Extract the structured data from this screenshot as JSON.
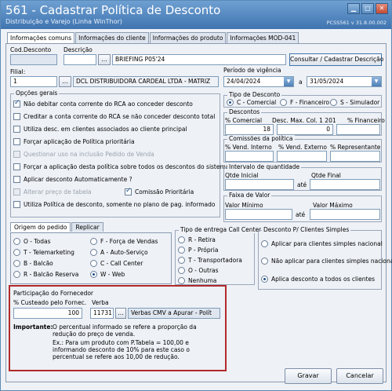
{
  "window": {
    "title": "561 - Cadastrar Política de Desconto",
    "subtitle": "Distribuição e Varejo (Linha WinThor)",
    "version": "PCSS561 v 31.8.00.002"
  },
  "tabs": [
    "Informações comuns",
    "Informações do cliente",
    "Informações do produto",
    "Informações MOD-041"
  ],
  "header": {
    "cod_desconto_label": "Cod.Desconto",
    "cod_desconto_value": "",
    "descricao_label": "Descrição",
    "descricao_code": "",
    "descricao_value": "BRIEFING P05'24",
    "consultar_button": "Consultar / Cadastrar Descrição",
    "filial_label": "Filial:",
    "filial_code": "1",
    "filial_name": "DCL DISTRIBUIDORA CARDEAL LTDA - MATRIZ",
    "vigencia_label": "Período de vigência",
    "vigencia_start": "24/04/2024",
    "vigencia_sep": "a",
    "vigencia_end": "31/05/2024"
  },
  "opcoes_gerais": {
    "title": "Opções gerais",
    "items": [
      {
        "label": "Não debitar conta corrente do RCA ao conceder desconto",
        "checked": true,
        "disabled": false
      },
      {
        "label": "Creditar a conta corrente do RCA se não conceder desconto total",
        "checked": false,
        "disabled": false
      },
      {
        "label": "Utiliza desc. em clientes associados ao cliente principal",
        "checked": false,
        "disabled": false
      },
      {
        "label": "Forçar aplicação de Política prioritária",
        "checked": false,
        "disabled": false
      },
      {
        "label": "Questionar uso na inclusão Pedido de Venda",
        "checked": false,
        "disabled": true
      },
      {
        "label": "Forçar a aplicação desta política sobre todos os descontos do sistema",
        "checked": false,
        "disabled": false
      },
      {
        "label": "Aplicar desconto Automaticamente ?",
        "checked": false,
        "disabled": false
      },
      {
        "label": "Alterar preço de tabela",
        "checked": false,
        "disabled": true
      },
      {
        "label": "Utiliza Política de desconto, somente no plano de pag. informado",
        "checked": false,
        "disabled": false
      }
    ],
    "comissao_label": "Comissão Prioritária",
    "comissao_checked": true
  },
  "tipo_desconto": {
    "title": "Tipo de Desconto",
    "options": [
      "C - Comercial",
      "F - Financeiro",
      "S - Simulador"
    ],
    "selected": 0
  },
  "descontos": {
    "title": "Descontos",
    "col1": "% Comercial",
    "col2": "Desc. Max. Col. 1 201",
    "col3": "% Financeiro",
    "val1": "18",
    "val2": "0",
    "val3": ""
  },
  "comissoes": {
    "title": "Comissões da política",
    "col1": "% Vend. Interno",
    "col2": "% Vend. Externo",
    "col3": "% Representante"
  },
  "intervalo": {
    "title": "Intervalo de quantidade",
    "ini": "Qtde Inicial",
    "fim": "Qtde Final",
    "ate": "até"
  },
  "faixa": {
    "title": "Faixa de Valor",
    "min": "Valor Mínimo",
    "max": "Valor Máximo",
    "ate": "até"
  },
  "subtabs": [
    "Origem do pedido",
    "Replicar"
  ],
  "origem": {
    "options": [
      "O - Todas",
      "F - Força de Vendas",
      "T - Telemarketing",
      "A - Auto-Serviço",
      "B - Balcão",
      "C - Call Center",
      "R - Balcão Reserva",
      "W - Web"
    ],
    "selected": 7
  },
  "tipo_entrega": {
    "title": "Tipo de entrega Call Center",
    "options": [
      "R - Retira",
      "P - Própria",
      "T - Transportadora",
      "O - Outras",
      "Nenhuma"
    ],
    "selected": -1
  },
  "simples": {
    "title": "Desconto P/ Clientes Simples",
    "options": [
      "Aplicar para clientes simples nacional",
      "Não aplicar para clientes simples nacional",
      "Aplica desconto a todos os clientes"
    ],
    "selected": 2
  },
  "fornecedor": {
    "title": "Participação do Fornecedor",
    "custeado_label": "% Custeado pelo Fornec.",
    "custeado_value": "100",
    "verba_label": "Verba",
    "verba_value": "11731",
    "verba_desc": "Verbas CMV a Apurar - Polít",
    "importante_label": "Importante:",
    "importante_text": "O percentual informado se refere a proporção da redução do preço de venda.",
    "exemplo_text": "Ex.: Para um produto com P.Tabela = 100,00 e informando desconto de 10% para este caso o percentual se refere aos 10,00 de redução."
  },
  "footer": {
    "save_label": "Gravar",
    "cancel_label": "Cancelar"
  }
}
